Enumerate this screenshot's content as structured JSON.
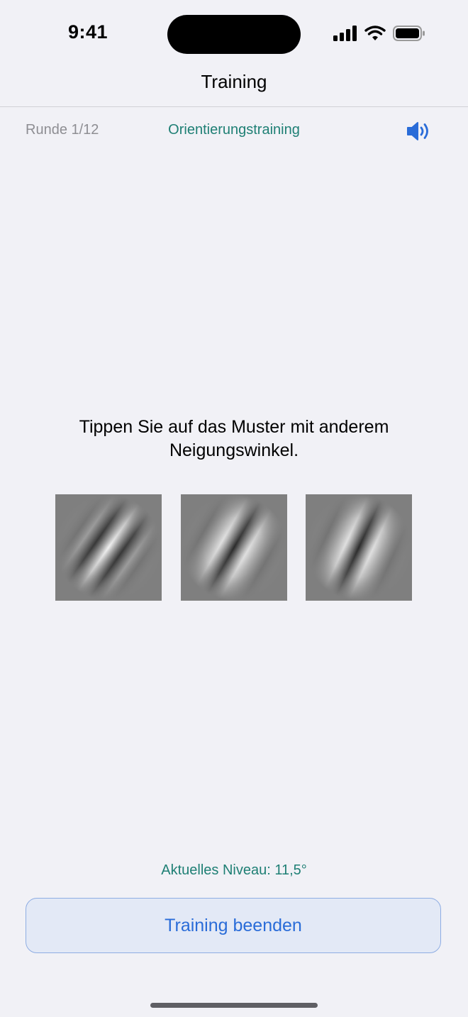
{
  "status_bar": {
    "time": "9:41"
  },
  "nav": {
    "title": "Training"
  },
  "session": {
    "round_label": "Runde 1/12",
    "mode_label": "Orientierungstraining",
    "sound_icon": "speaker-wave-icon"
  },
  "task": {
    "instruction": "Tippen Sie auf das Muster mit anderem Neigungswinkel.",
    "stimuli": [
      {
        "type": "gabor-patch",
        "orientation_deg": 35
      },
      {
        "type": "gabor-patch",
        "orientation_deg": 30
      },
      {
        "type": "gabor-patch",
        "orientation_deg": 25
      }
    ]
  },
  "footer": {
    "level_label": "Aktuelles Niveau: 11,5°",
    "end_button_label": "Training beenden"
  },
  "colors": {
    "accent_teal": "#1E7F74",
    "accent_blue": "#2A6CD8",
    "background": "#F1F1F6"
  }
}
